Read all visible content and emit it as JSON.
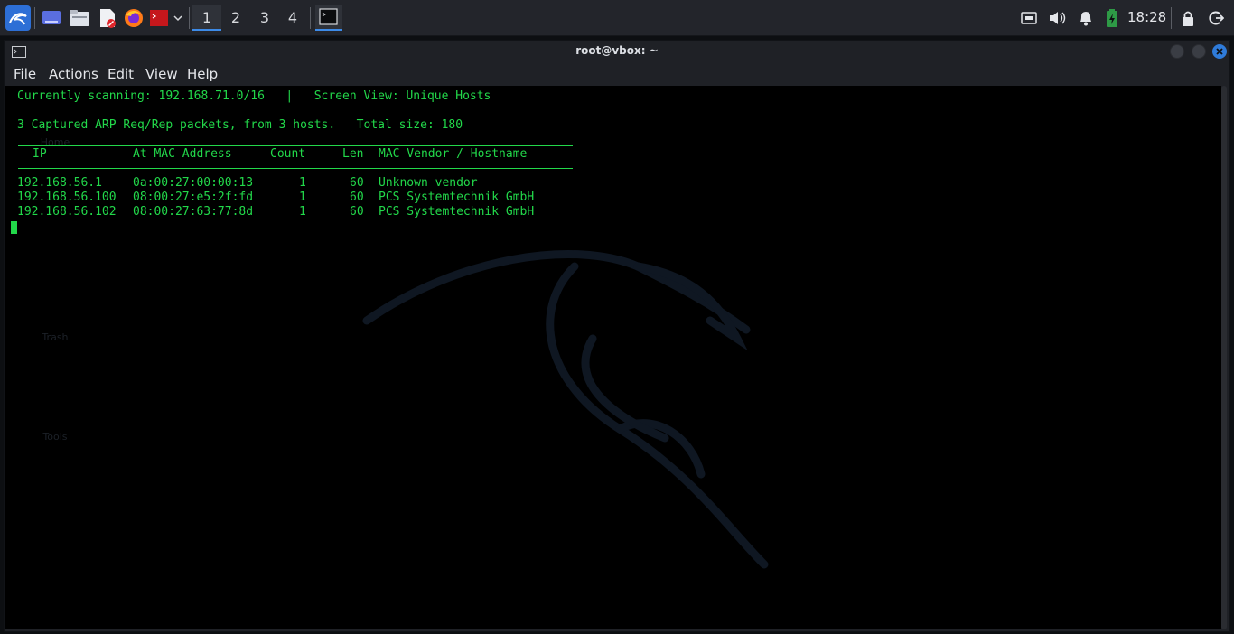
{
  "panel": {
    "workspaces": [
      "1",
      "2",
      "3",
      "4"
    ],
    "active_workspace": "1",
    "clock": "18:28"
  },
  "window": {
    "title": "root@vbox: ~",
    "menu": [
      "File",
      "Actions",
      "Edit",
      "View",
      "Help"
    ]
  },
  "terminal": {
    "status_line": "Currently scanning: 192.168.71.0/16   |   Screen View: Unique Hosts",
    "summary_line": "3 Captured ARP Req/Rep packets, from 3 hosts.   Total size: 180",
    "columns": [
      "IP",
      "At MAC Address",
      "Count",
      "Len",
      "MAC Vendor / Hostname"
    ],
    "rows": [
      {
        "ip": "192.168.56.1",
        "mac": "0a:00:27:00:00:13",
        "count": "1",
        "len": "60",
        "vendor": "Unknown vendor"
      },
      {
        "ip": "192.168.56.100",
        "mac": "08:00:27:e5:2f:fd",
        "count": "1",
        "len": "60",
        "vendor": "PCS Systemtechnik GmbH"
      },
      {
        "ip": "192.168.56.102",
        "mac": "08:00:27:63:77:8d",
        "count": "1",
        "len": "60",
        "vendor": "PCS Systemtechnik GmbH"
      }
    ]
  },
  "colors": {
    "terminal_text": "#22d84a",
    "accent": "#3d8be8",
    "panel_bg": "#23252b"
  }
}
